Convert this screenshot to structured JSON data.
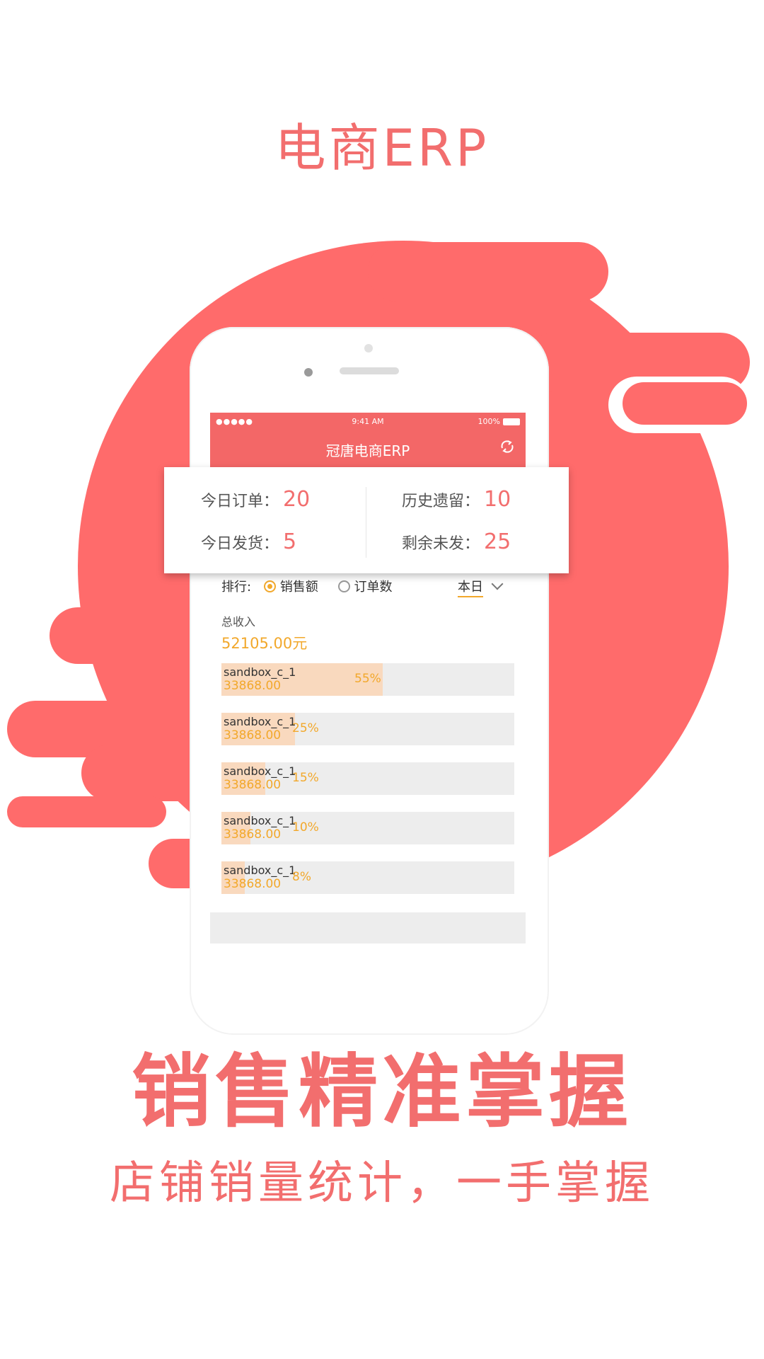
{
  "page": {
    "title": "电商ERP",
    "headline": "销售精准掌握",
    "subline": "店铺销量统计，一手掌握"
  },
  "colors": {
    "accent": "#F26E6E",
    "blob": "#FF6B6B",
    "highlight": "#F2A82B",
    "bar": "#F9D9BE"
  },
  "status_bar": {
    "signal": "●●●●● ",
    "time": "9:41 AM",
    "battery": "100%"
  },
  "app": {
    "title": "冠唐电商ERP",
    "refresh_icon": "refresh-icon",
    "stats": {
      "today_orders": {
        "label": "今日订单：",
        "value": "20"
      },
      "history_left": {
        "label": "历史遗留：",
        "value": "10"
      },
      "today_shipped": {
        "label": "今日发货：",
        "value": "5"
      },
      "remaining": {
        "label": "剩余未发：",
        "value": "25"
      }
    },
    "ranking": {
      "label": "排行:",
      "option_sales": "销售额",
      "option_orders": "订单数",
      "selected": "销售额",
      "period": "本日"
    },
    "total": {
      "label": "总收入",
      "value": "52105.00元"
    },
    "bars": [
      {
        "name": "sandbox_c_1",
        "amount": "33868.00",
        "percent_label": "55%",
        "percent": 55
      },
      {
        "name": "sandbox_c_1",
        "amount": "33868.00",
        "percent_label": "25%",
        "percent": 25
      },
      {
        "name": "sandbox_c_1",
        "amount": "33868.00",
        "percent_label": "15%",
        "percent": 15
      },
      {
        "name": "sandbox_c_1",
        "amount": "33868.00",
        "percent_label": "10%",
        "percent": 10
      },
      {
        "name": "sandbox_c_1",
        "amount": "33868.00",
        "percent_label": "8%",
        "percent": 8
      }
    ]
  }
}
